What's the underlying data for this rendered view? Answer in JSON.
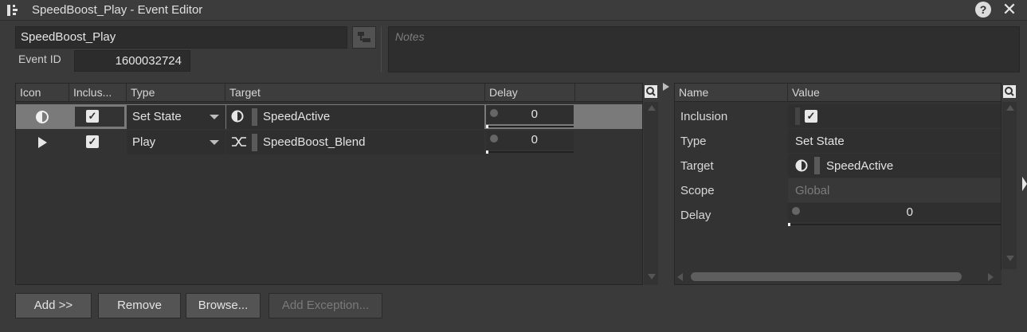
{
  "window": {
    "title": "SpeedBoost_Play - Event Editor",
    "help_label": "?",
    "close_label": "✕"
  },
  "header": {
    "name_value": "SpeedBoost_Play",
    "event_id_label": "Event ID",
    "event_id_value": "1600032724",
    "notes_placeholder": "Notes"
  },
  "actions_table": {
    "columns": [
      "Icon",
      "Inclus...",
      "Type",
      "Target",
      "Delay"
    ],
    "rows": [
      {
        "icon": "set-state-icon",
        "inclusion": true,
        "type": "Set State",
        "target_icon": "state-icon",
        "target": "SpeedActive",
        "delay": "0",
        "selected": true
      },
      {
        "icon": "play-icon",
        "inclusion": true,
        "type": "Play",
        "target_icon": "blend-icon",
        "target": "SpeedBoost_Blend",
        "delay": "0",
        "selected": false
      }
    ]
  },
  "properties": {
    "columns": [
      "Name",
      "Value"
    ],
    "rows": [
      {
        "name": "Inclusion",
        "value": "",
        "kind": "checkbox"
      },
      {
        "name": "Type",
        "value": "Set State",
        "kind": "text"
      },
      {
        "name": "Target",
        "value": "SpeedActive",
        "kind": "target"
      },
      {
        "name": "Scope",
        "value": "Global",
        "kind": "disabled"
      },
      {
        "name": "Delay",
        "value": "0",
        "kind": "slider"
      }
    ]
  },
  "buttons": {
    "add": "Add >>",
    "remove": "Remove",
    "browse": "Browse...",
    "add_exception": "Add Exception..."
  },
  "colors": {
    "background": "#3a3a3a",
    "selected_row": "#7a7a7a",
    "field": "#2f2f2f"
  }
}
